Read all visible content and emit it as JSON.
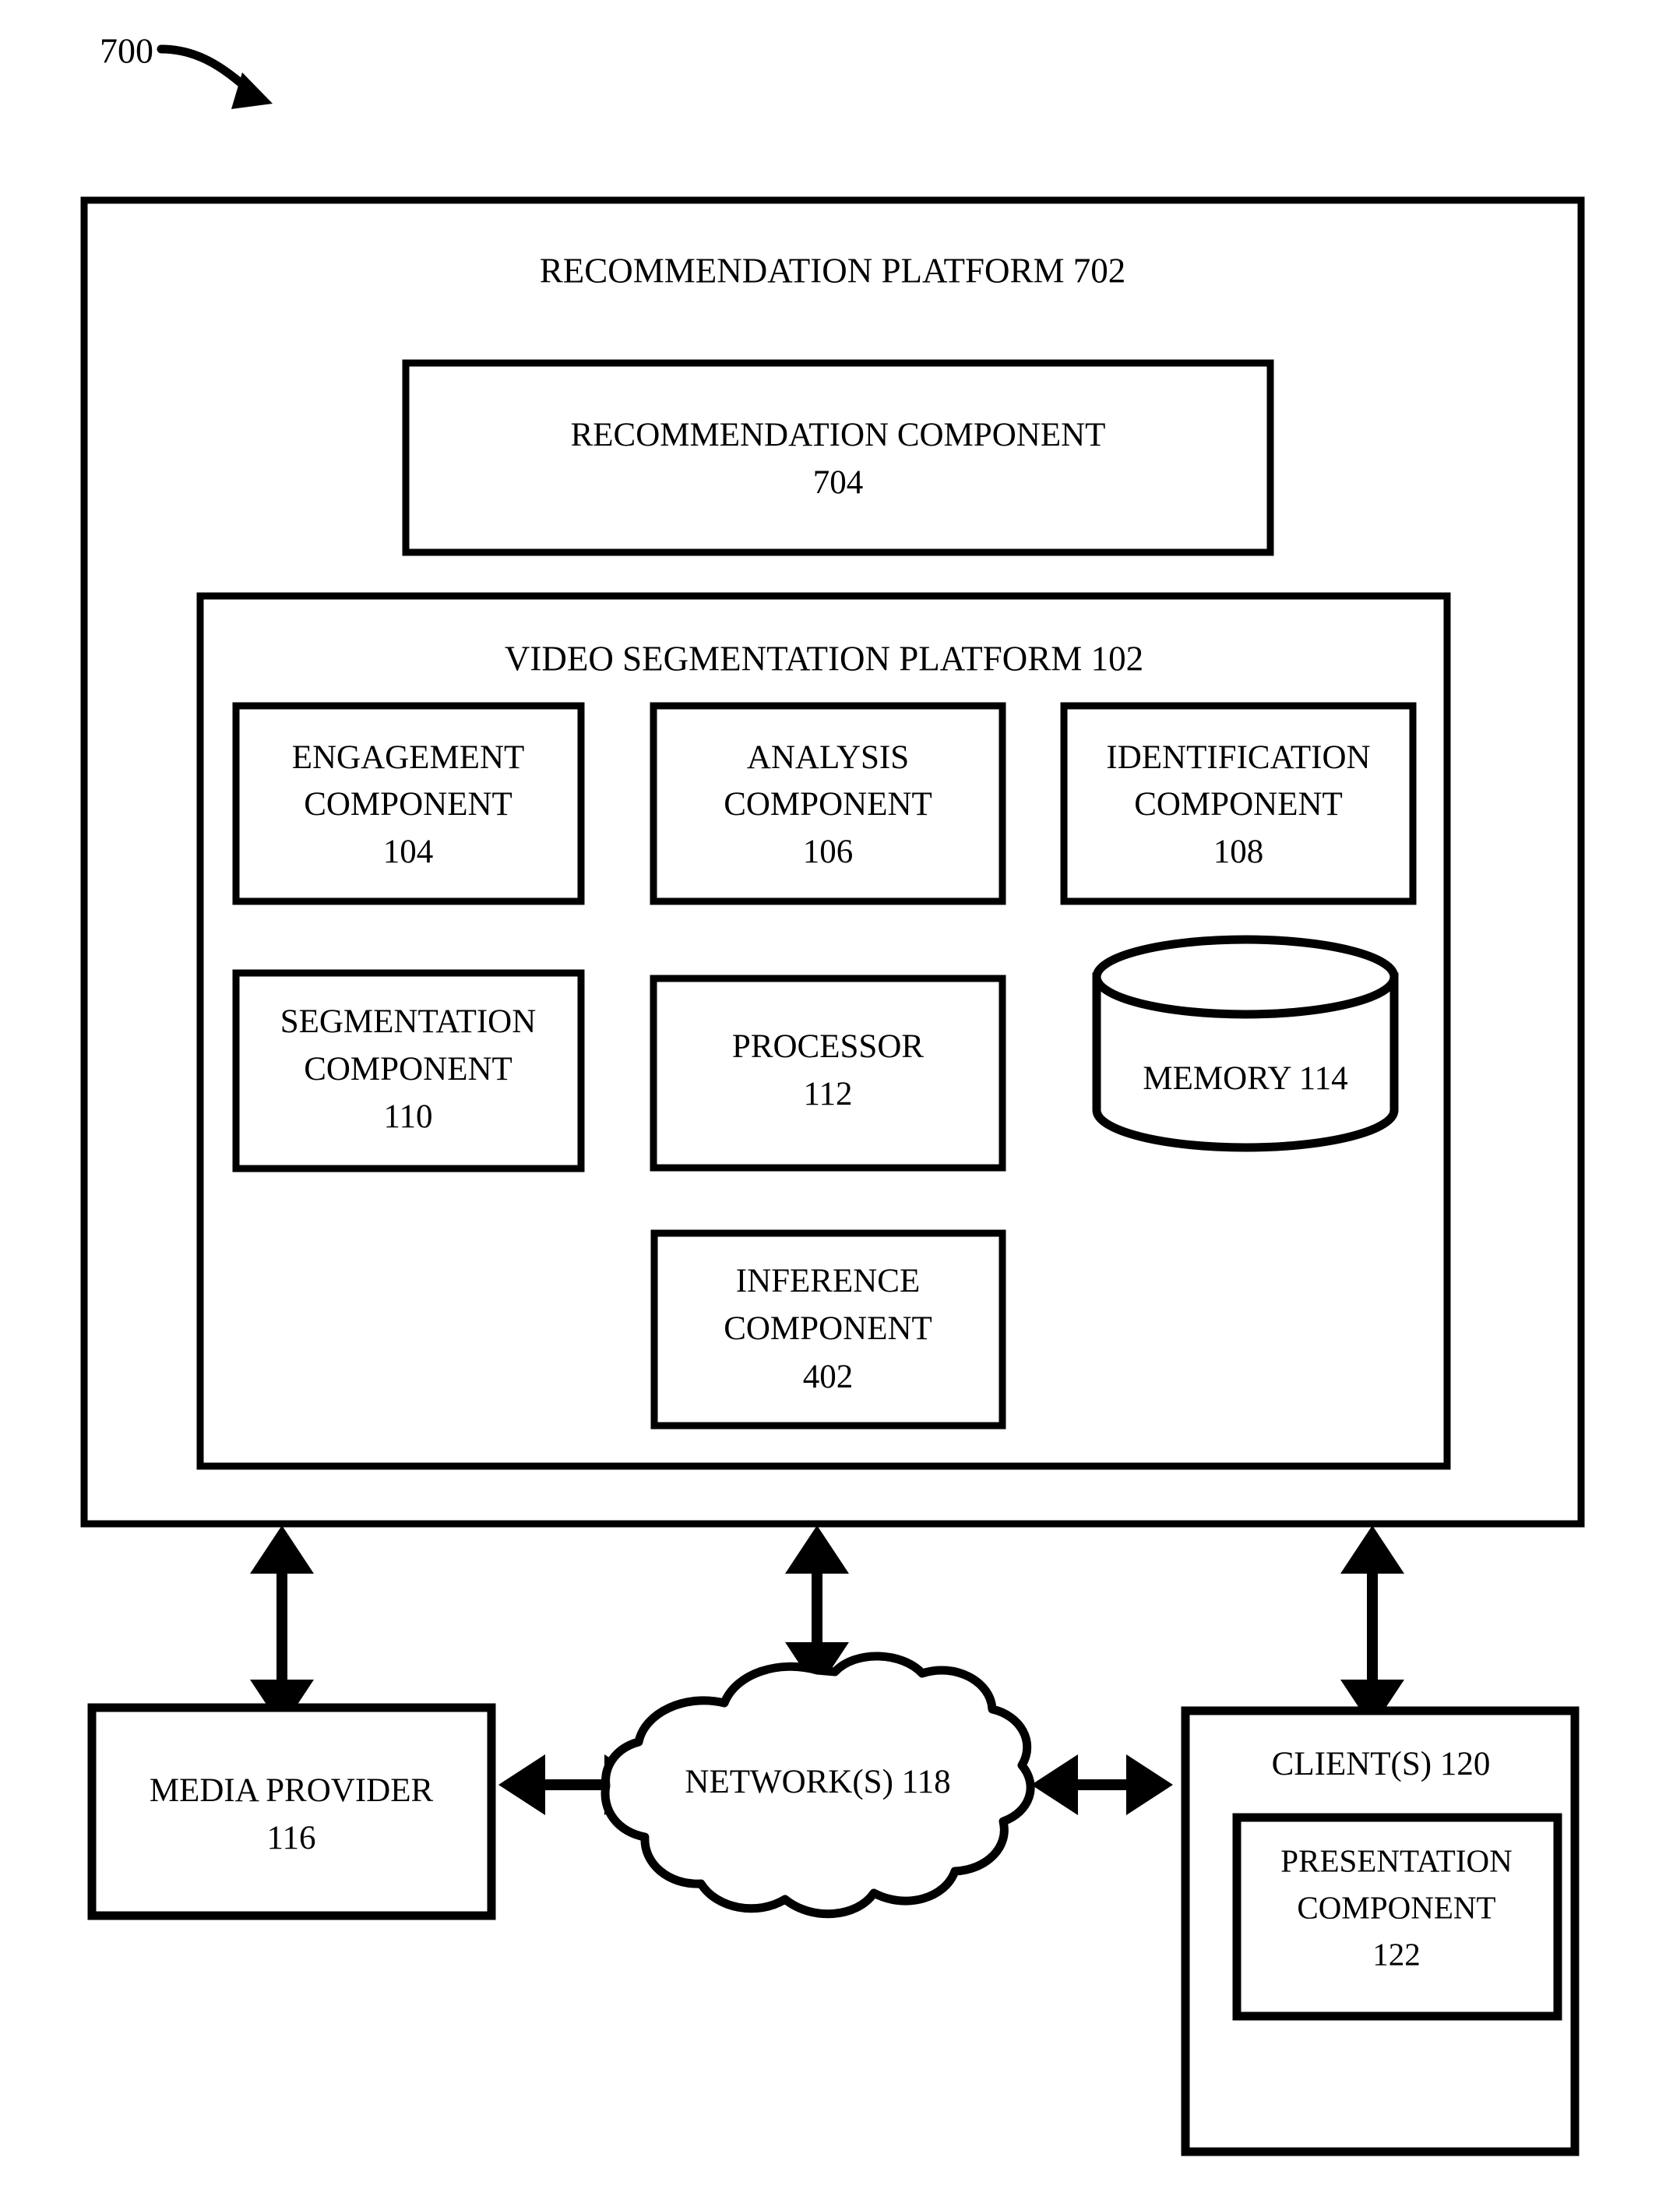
{
  "figure": {
    "number": "700",
    "pointer_icon": "curved-arrow-icon"
  },
  "outer_platform": {
    "title": "RECOMMENDATION PLATFORM 702",
    "name": "RECOMMENDATION PLATFORM",
    "ref": "702"
  },
  "recommendation_component": {
    "line1": "RECOMMENDATION COMPONENT",
    "line2": "704"
  },
  "video_segmentation_platform": {
    "title": "VIDEO SEGMENTATION PLATFORM 102",
    "name": "VIDEO SEGMENTATION PLATFORM",
    "ref": "102"
  },
  "components": [
    {
      "line1": "ENGAGEMENT",
      "line2": "COMPONENT",
      "line3": "104"
    },
    {
      "line1": "ANALYSIS",
      "line2": "COMPONENT",
      "line3": "106"
    },
    {
      "line1": "IDENTIFICATION",
      "line2": "COMPONENT",
      "line3": "108"
    },
    {
      "line1": "SEGMENTATION",
      "line2": "COMPONENT",
      "line3": "110"
    },
    {
      "line1": "PROCESSOR",
      "line2": "112",
      "line3": ""
    },
    {
      "line1": "INFERENCE",
      "line2": "COMPONENT",
      "line3": "402"
    }
  ],
  "memory": {
    "label": "MEMORY 114",
    "shape": "cylinder"
  },
  "media_provider": {
    "line1": "MEDIA PROVIDER",
    "line2": "116"
  },
  "network": {
    "label": "NETWORK(S) 118",
    "shape": "cloud"
  },
  "clients": {
    "label": "CLIENT(S) 120"
  },
  "presentation_component": {
    "line1": "PRESENTATION",
    "line2": "COMPONENT",
    "line3": "122"
  },
  "connectors": [
    {
      "name": "platform-to-media-provider",
      "orientation": "vertical",
      "double_headed": true
    },
    {
      "name": "platform-to-network",
      "orientation": "vertical",
      "double_headed": true
    },
    {
      "name": "platform-to-clients",
      "orientation": "vertical",
      "double_headed": true
    },
    {
      "name": "media-provider-to-network",
      "orientation": "horizontal",
      "double_headed": true
    },
    {
      "name": "network-to-clients",
      "orientation": "horizontal",
      "double_headed": true
    }
  ],
  "colors": {
    "stroke": "#000000",
    "background": "#ffffff"
  }
}
